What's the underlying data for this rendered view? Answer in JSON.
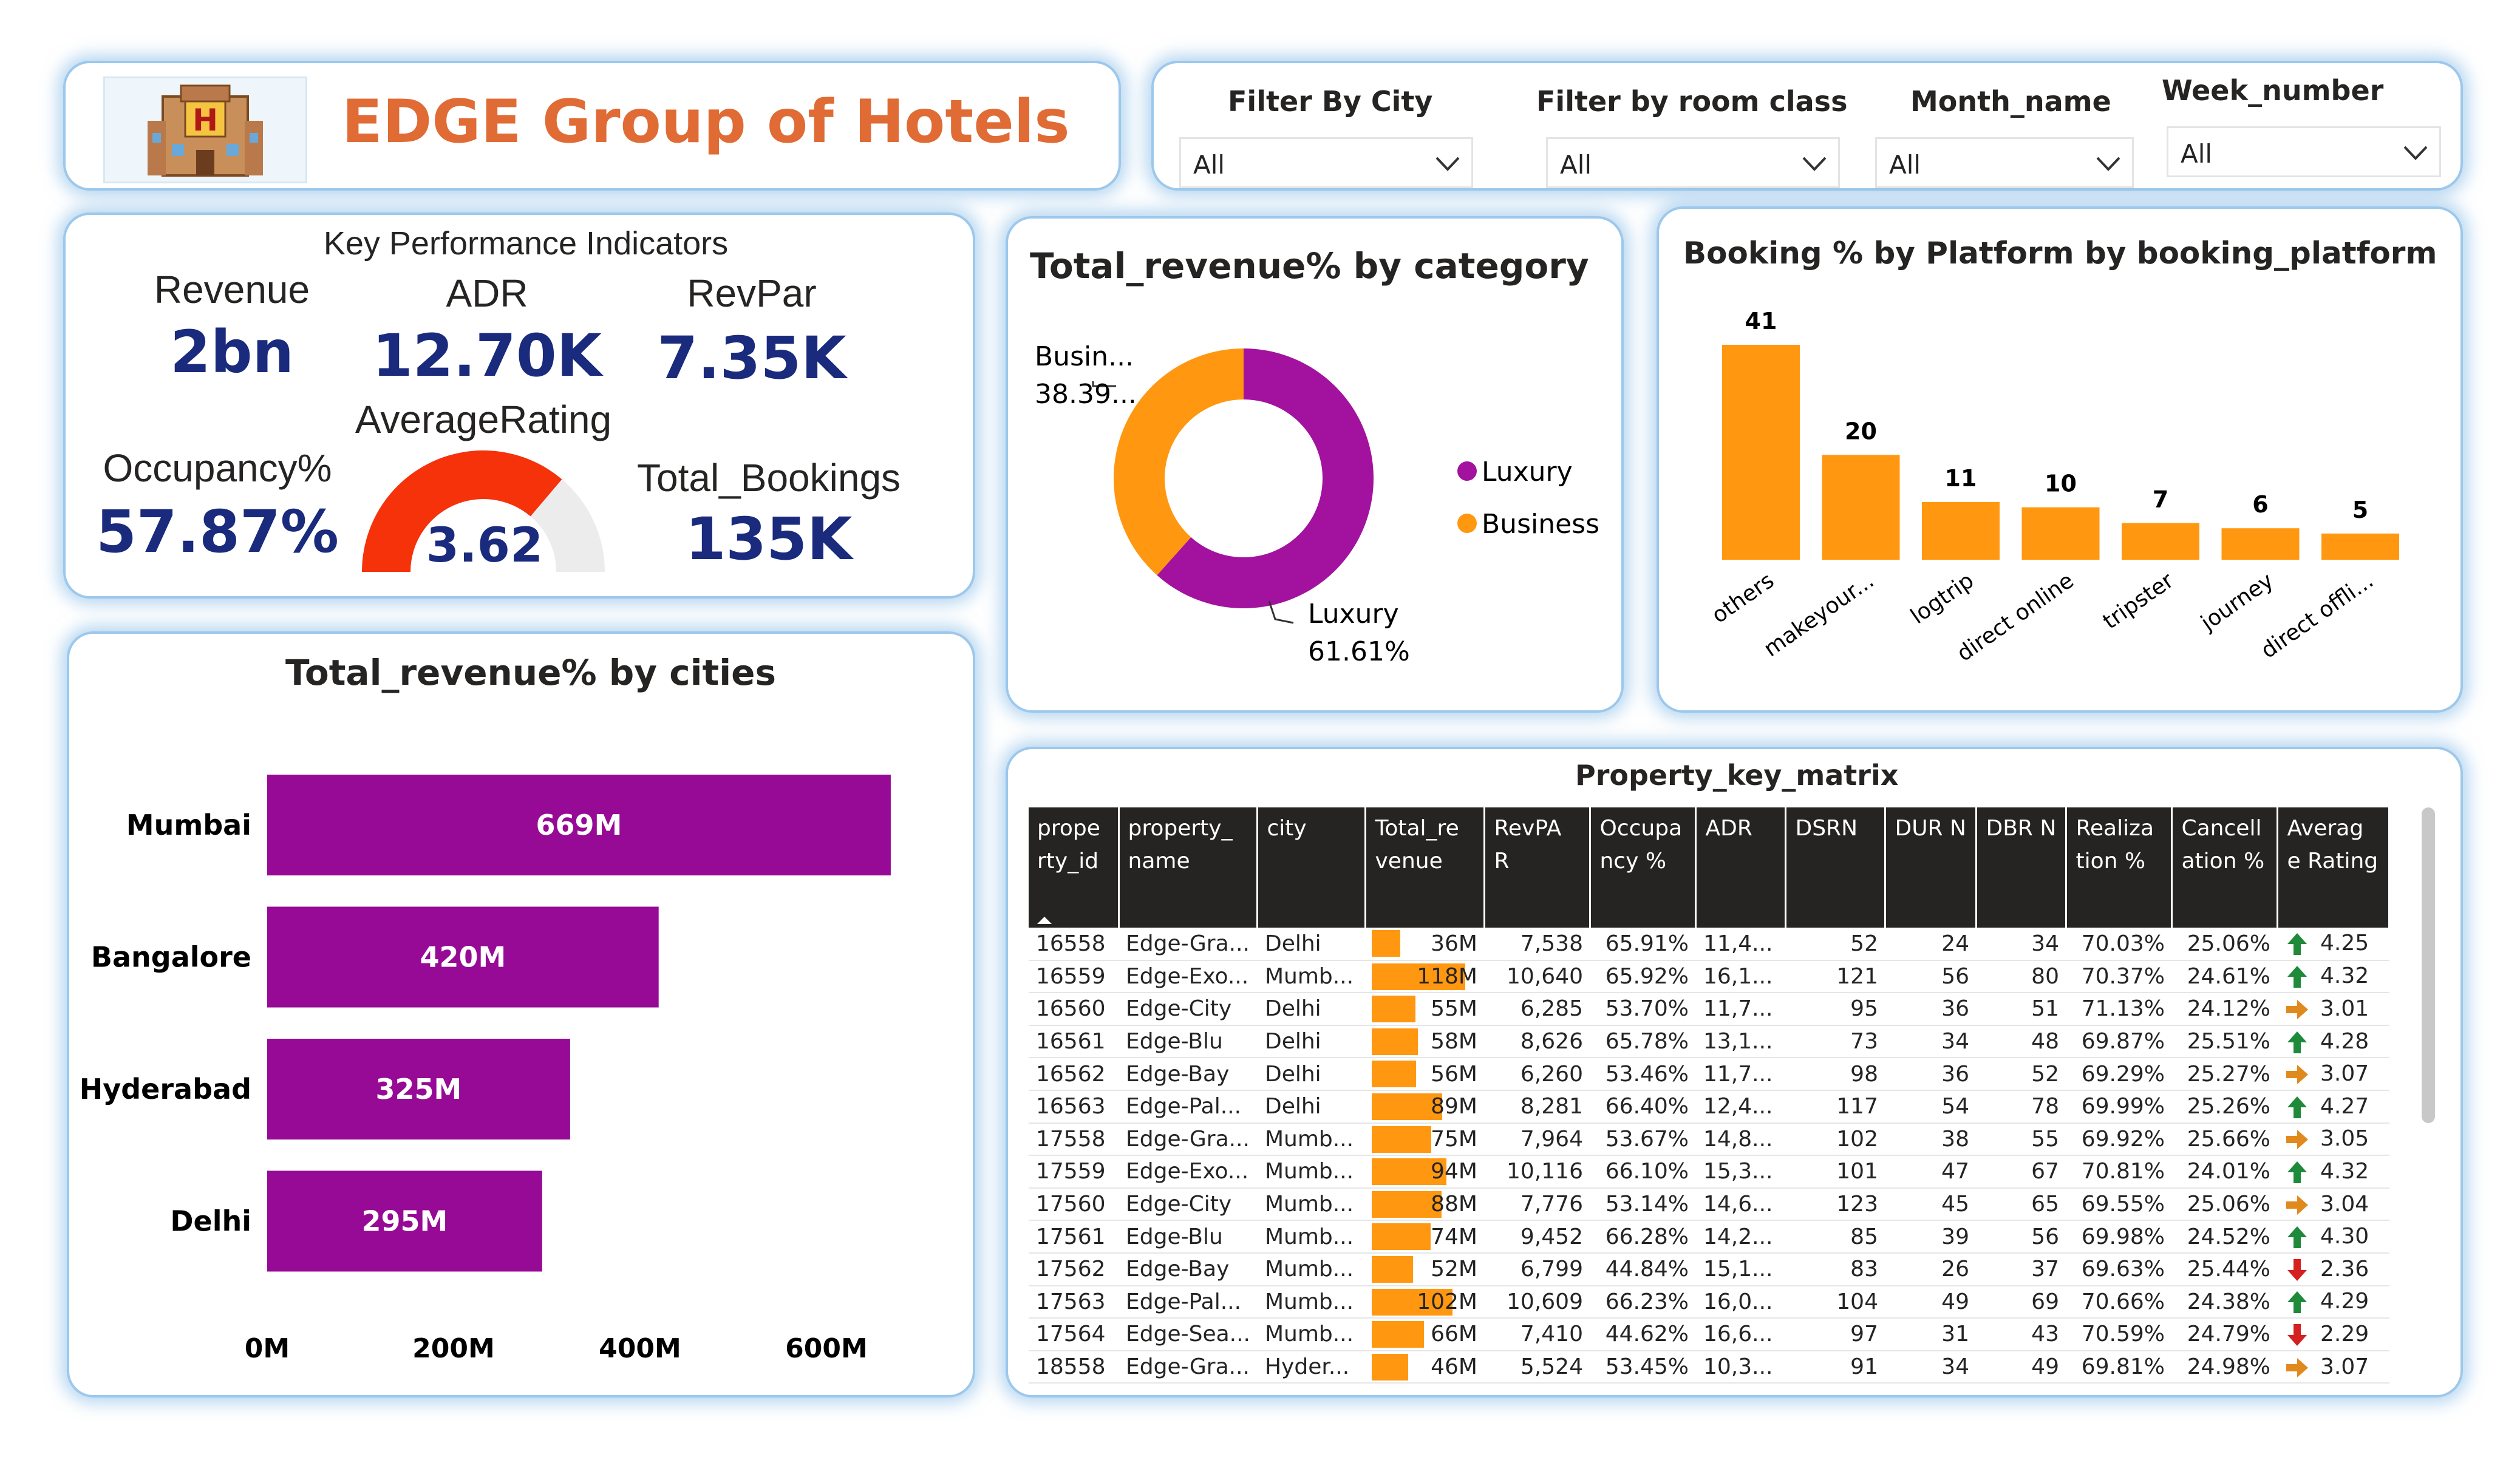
{
  "header": {
    "title": "EDGE Group of Hotels",
    "logo_letter": "H"
  },
  "filters": [
    {
      "label": "Filter By City",
      "value": "All"
    },
    {
      "label": "Filter by room class",
      "value": "All"
    },
    {
      "label": "Month_name",
      "value": "All"
    },
    {
      "label": "Week_number",
      "value": "All"
    }
  ],
  "kpi": {
    "title": "Key Performance Indicators",
    "revenue_label": "Revenue",
    "revenue_value": "2bn",
    "adr_label": "ADR",
    "adr_value": "12.70K",
    "revpar_label": "RevPar",
    "revpar_value": "7.35K",
    "occupancy_label": "Occupancy%",
    "occupancy_value": "57.87%",
    "rating_label": "AverageRating",
    "rating_value": "3.62",
    "rating_fraction": 0.724,
    "bookings_label": "Total_Bookings",
    "bookings_value": "135K"
  },
  "chart_data": [
    {
      "type": "pie",
      "title": "Total_revenue% by category",
      "categories": [
        "Luxury",
        "Business"
      ],
      "values": [
        61.61,
        38.39
      ],
      "colors": [
        "#a2129f",
        "#ff9810"
      ],
      "labels": [
        {
          "name": "Luxury",
          "value": "61.61%"
        },
        {
          "name": "Busin...",
          "value": "38.39..."
        }
      ],
      "legend": [
        "Luxury",
        "Business"
      ]
    },
    {
      "type": "bar",
      "title": "Booking % by Platform by booking_platform",
      "categories": [
        "others",
        "makeyour...",
        "logtrip",
        "direct online",
        "tripster",
        "journey",
        "direct offli..."
      ],
      "values": [
        41,
        20,
        11,
        10,
        7,
        6,
        5
      ],
      "color": "#ff9810"
    },
    {
      "type": "bar",
      "orientation": "horizontal",
      "title": "Total_revenue% by cities",
      "categories": [
        "Mumbai",
        "Bangalore",
        "Hyderabad",
        "Delhi"
      ],
      "values": [
        669,
        420,
        325,
        295
      ],
      "labels": [
        "669M",
        "420M",
        "325M",
        "295M"
      ],
      "xticks": [
        "0M",
        "200M",
        "400M",
        "600M"
      ],
      "xlim": [
        0,
        700
      ],
      "color": "#960a96"
    }
  ],
  "matrix": {
    "title": "Property_key_matrix",
    "columns": [
      "prope rty_id",
      "property_ name",
      "city",
      "Total_re venue",
      "RevPA R",
      "Occupa ncy %",
      "ADR",
      "DSRN",
      "DUR N",
      "DBR N",
      "Realiza tion %",
      "Cancell ation %",
      "Averag e Rating"
    ],
    "rows": [
      [
        "16558",
        "Edge-Gra...",
        "Delhi",
        "36M",
        36,
        "7,538",
        "65.91%",
        "11,4...",
        "52",
        "24",
        "34",
        "70.03%",
        "25.06%",
        "up",
        "4.25"
      ],
      [
        "16559",
        "Edge-Exo...",
        "Mumb...",
        "118M",
        118,
        "10,640",
        "65.92%",
        "16,1...",
        "121",
        "56",
        "80",
        "70.37%",
        "24.61%",
        "up",
        "4.32"
      ],
      [
        "16560",
        "Edge-City",
        "Delhi",
        "55M",
        55,
        "6,285",
        "53.70%",
        "11,7...",
        "95",
        "36",
        "51",
        "71.13%",
        "24.12%",
        "right",
        "3.01"
      ],
      [
        "16561",
        "Edge-Blu",
        "Delhi",
        "58M",
        58,
        "8,626",
        "65.78%",
        "13,1...",
        "73",
        "34",
        "48",
        "69.87%",
        "25.51%",
        "up",
        "4.28"
      ],
      [
        "16562",
        "Edge-Bay",
        "Delhi",
        "56M",
        56,
        "6,260",
        "53.46%",
        "11,7...",
        "98",
        "36",
        "52",
        "69.29%",
        "25.27%",
        "right",
        "3.07"
      ],
      [
        "16563",
        "Edge-Pal...",
        "Delhi",
        "89M",
        89,
        "8,281",
        "66.40%",
        "12,4...",
        "117",
        "54",
        "78",
        "69.99%",
        "25.26%",
        "up",
        "4.27"
      ],
      [
        "17558",
        "Edge-Gra...",
        "Mumb...",
        "75M",
        75,
        "7,964",
        "53.67%",
        "14,8...",
        "102",
        "38",
        "55",
        "69.92%",
        "25.66%",
        "right",
        "3.05"
      ],
      [
        "17559",
        "Edge-Exo...",
        "Mumb...",
        "94M",
        94,
        "10,116",
        "66.10%",
        "15,3...",
        "101",
        "47",
        "67",
        "70.81%",
        "24.01%",
        "up",
        "4.32"
      ],
      [
        "17560",
        "Edge-City",
        "Mumb...",
        "88M",
        88,
        "7,776",
        "53.14%",
        "14,6...",
        "123",
        "45",
        "65",
        "69.55%",
        "25.06%",
        "right",
        "3.04"
      ],
      [
        "17561",
        "Edge-Blu",
        "Mumb...",
        "74M",
        74,
        "9,452",
        "66.28%",
        "14,2...",
        "85",
        "39",
        "56",
        "69.98%",
        "24.52%",
        "up",
        "4.30"
      ],
      [
        "17562",
        "Edge-Bay",
        "Mumb...",
        "52M",
        52,
        "6,799",
        "44.84%",
        "15,1...",
        "83",
        "26",
        "37",
        "69.63%",
        "25.44%",
        "down",
        "2.36"
      ],
      [
        "17563",
        "Edge-Pal...",
        "Mumb...",
        "102M",
        102,
        "10,609",
        "66.23%",
        "16,0...",
        "104",
        "49",
        "69",
        "70.66%",
        "24.38%",
        "up",
        "4.29"
      ],
      [
        "17564",
        "Edge-Sea...",
        "Mumb...",
        "66M",
        66,
        "7,410",
        "44.62%",
        "16,6...",
        "97",
        "31",
        "43",
        "70.59%",
        "24.79%",
        "down",
        "2.29"
      ],
      [
        "18558",
        "Edge-Gra...",
        "Hyder...",
        "46M",
        46,
        "5,524",
        "53.45%",
        "10,3...",
        "91",
        "34",
        "49",
        "69.81%",
        "24.98%",
        "right",
        "3.07"
      ]
    ]
  }
}
